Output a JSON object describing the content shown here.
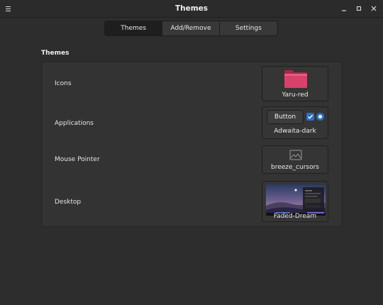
{
  "window": {
    "title": "Themes"
  },
  "tabs": [
    {
      "label": "Themes",
      "active": true
    },
    {
      "label": "Add/Remove",
      "active": false
    },
    {
      "label": "Settings",
      "active": false
    }
  ],
  "section": {
    "title": "Themes"
  },
  "rows": [
    {
      "label": "Icons",
      "value": "Yaru-red",
      "icon": "folder-icon"
    },
    {
      "label": "Applications",
      "value": "Adwaita-dark",
      "button_label": "Button"
    },
    {
      "label": "Mouse Pointer",
      "value": "breeze_cursors",
      "icon": "image-placeholder-icon"
    },
    {
      "label": "Desktop",
      "value": "Faded-Dream",
      "icon": "wallpaper-thumbnail"
    }
  ],
  "colors": {
    "background": "#2d2d2d",
    "panel": "#333333",
    "accent": "#2e6fc2",
    "folder": "#c4325a"
  }
}
